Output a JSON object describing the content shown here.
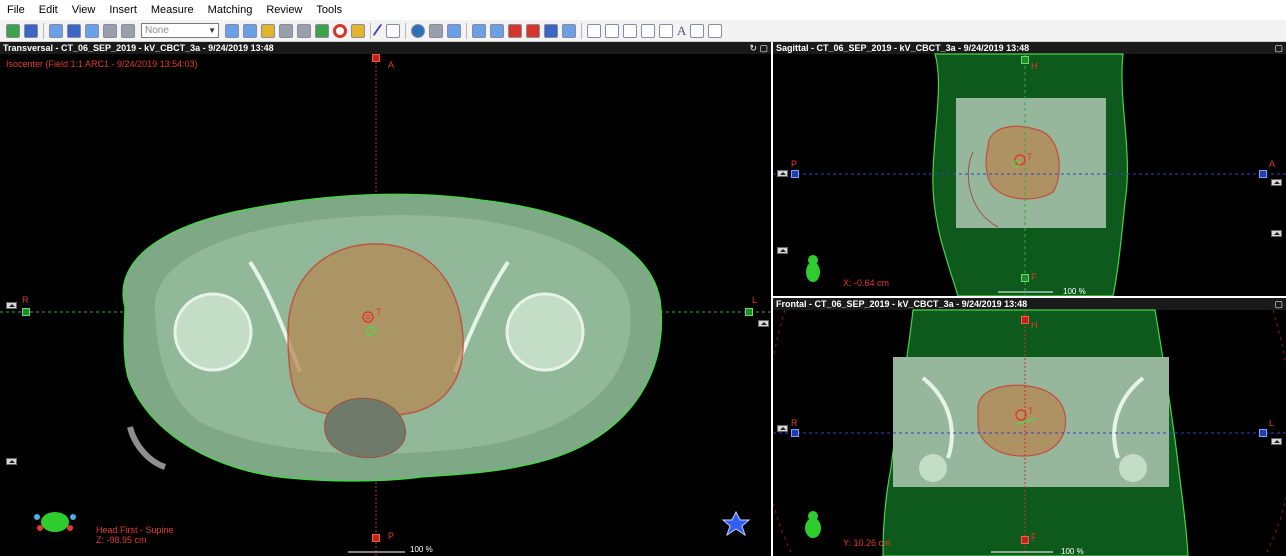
{
  "menu": [
    "File",
    "Edit",
    "View",
    "Insert",
    "Measure",
    "Matching",
    "Review",
    "Tools"
  ],
  "toolbar": {
    "select_value": "None"
  },
  "transversal": {
    "title": "Transversal - CT_06_SEP_2019 - kV_CBCT_3a - 9/24/2019 13:48",
    "isocenter": "Isocenter (Field 1:1 ARC1 - 9/24/2019 13:54:03)",
    "orient_top": "A",
    "orient_bottom": "P",
    "orient_left": "R",
    "orient_right": "L",
    "patient_position": "Head First - Supine",
    "coord": "Z: -98.95 cm",
    "zoom": "100 %",
    "target_label": "T"
  },
  "sagittal": {
    "title": "Sagittal - CT_06_SEP_2019 - kV_CBCT_3a - 9/24/2019 13:48",
    "orient_top": "H",
    "orient_bottom": "F",
    "orient_left": "P",
    "orient_right": "A",
    "coord": "X: -0.64 cm",
    "zoom": "100 %",
    "target_label": "T"
  },
  "frontal": {
    "title": "Frontal - CT_06_SEP_2019 - kV_CBCT_3a - 9/24/2019 13:48",
    "orient_top": "H",
    "orient_bottom": "F",
    "orient_left": "R",
    "orient_right": "L",
    "coord": "Y: 10.26 cm",
    "zoom": "100 %",
    "target_label": "T"
  },
  "colors": {
    "anatomy": "#8fb89a",
    "outline": "#4cd94c",
    "target": "#d0342a",
    "crosshair_red": "#c8341f",
    "crosshair_green": "#2fae3a",
    "crosshair_blue": "#2f43c4"
  }
}
